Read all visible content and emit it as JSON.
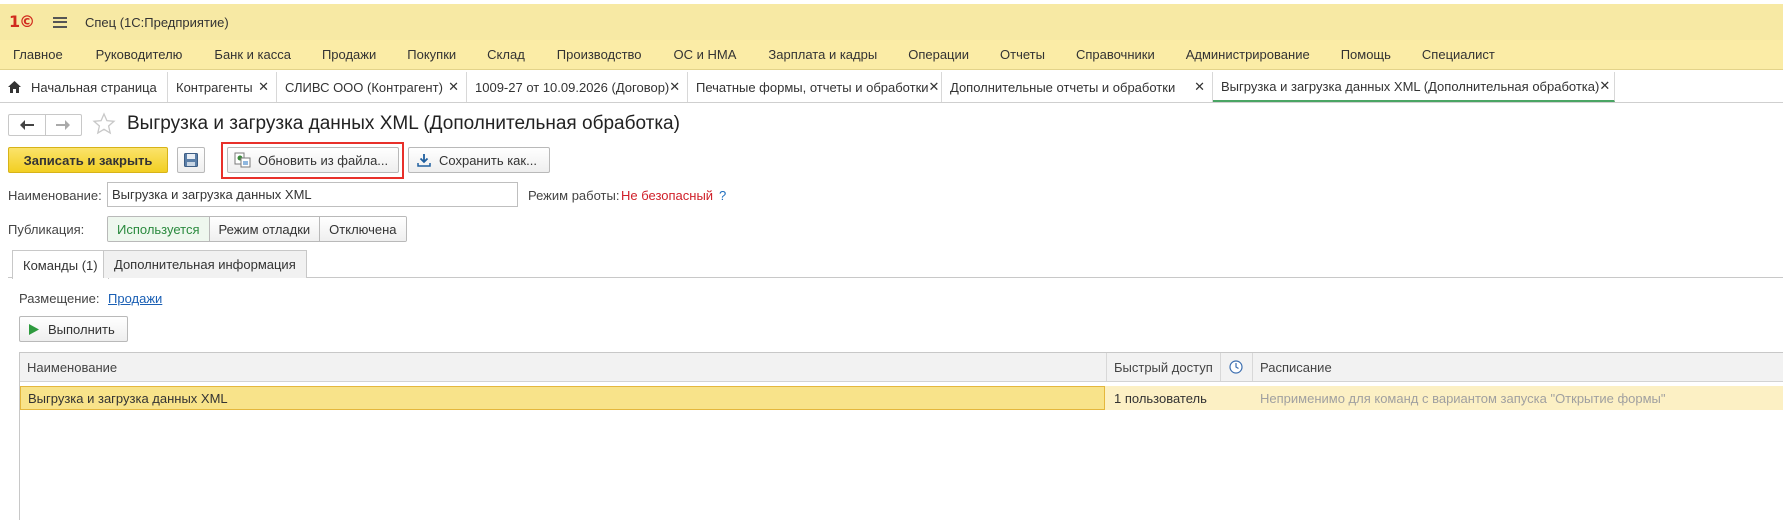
{
  "window": {
    "title": "Спец  (1С:Предприятие)"
  },
  "menu": [
    "Главное",
    "Руководителю",
    "Банк и касса",
    "Продажи",
    "Покупки",
    "Склад",
    "Производство",
    "ОС и НМА",
    "Зарплата и кадры",
    "Операции",
    "Отчеты",
    "Справочники",
    "Администрирование",
    "Помощь",
    "Специалист"
  ],
  "tabs": [
    "Начальная страница",
    "Контрагенты",
    "СЛИВС ООО (Контрагент)",
    "1009-27 от 10.09.2026 (Договор)",
    "Печатные формы, отчеты и обработки",
    "Дополнительные отчеты и обработки",
    "Выгрузка и загрузка данных XML (Дополнительная обработка)"
  ],
  "form": {
    "title": "Выгрузка и загрузка данных XML (Дополнительная обработка)",
    "btn_save_close": "Записать и закрыть",
    "btn_update_from_file": "Обновить из файла...",
    "btn_save_as": "Сохранить как...",
    "name_label": "Наименование:",
    "name_value": "Выгрузка и загрузка данных XML",
    "mode_label": "Режим работы:",
    "mode_value": "Не безопасный",
    "mode_help": "?",
    "publication_label": "Публикация:",
    "publication_options": [
      "Используется",
      "Режим отладки",
      "Отключена"
    ],
    "publication_selected": "Используется",
    "page_tabs": [
      "Команды (1)",
      "Дополнительная информация"
    ],
    "placement_label": "Размещение:",
    "placement_value": "Продажи",
    "btn_execute": "Выполнить"
  },
  "table": {
    "columns": [
      "Наименование",
      "Быстрый доступ",
      "",
      "Расписание"
    ],
    "rows": [
      {
        "name": "Выгрузка и загрузка данных XML",
        "quick_access": "1 пользователь",
        "schedule": "Неприменимо для команд с вариантом запуска \"Открытие формы\""
      }
    ]
  },
  "icons": [
    "1c-logo-icon",
    "menu-icon",
    "home-icon",
    "back-icon",
    "forward-icon",
    "star-icon",
    "floppy-icon",
    "file-update-icon",
    "download-icon",
    "play-icon",
    "clock-icon",
    "close-icon"
  ],
  "colors": {
    "titlebar": "#f7e9a4",
    "primary_button": "#f2cf22",
    "danger": "#d0202a",
    "highlight": "#e8302a",
    "row_selected": "#f8e38a"
  }
}
